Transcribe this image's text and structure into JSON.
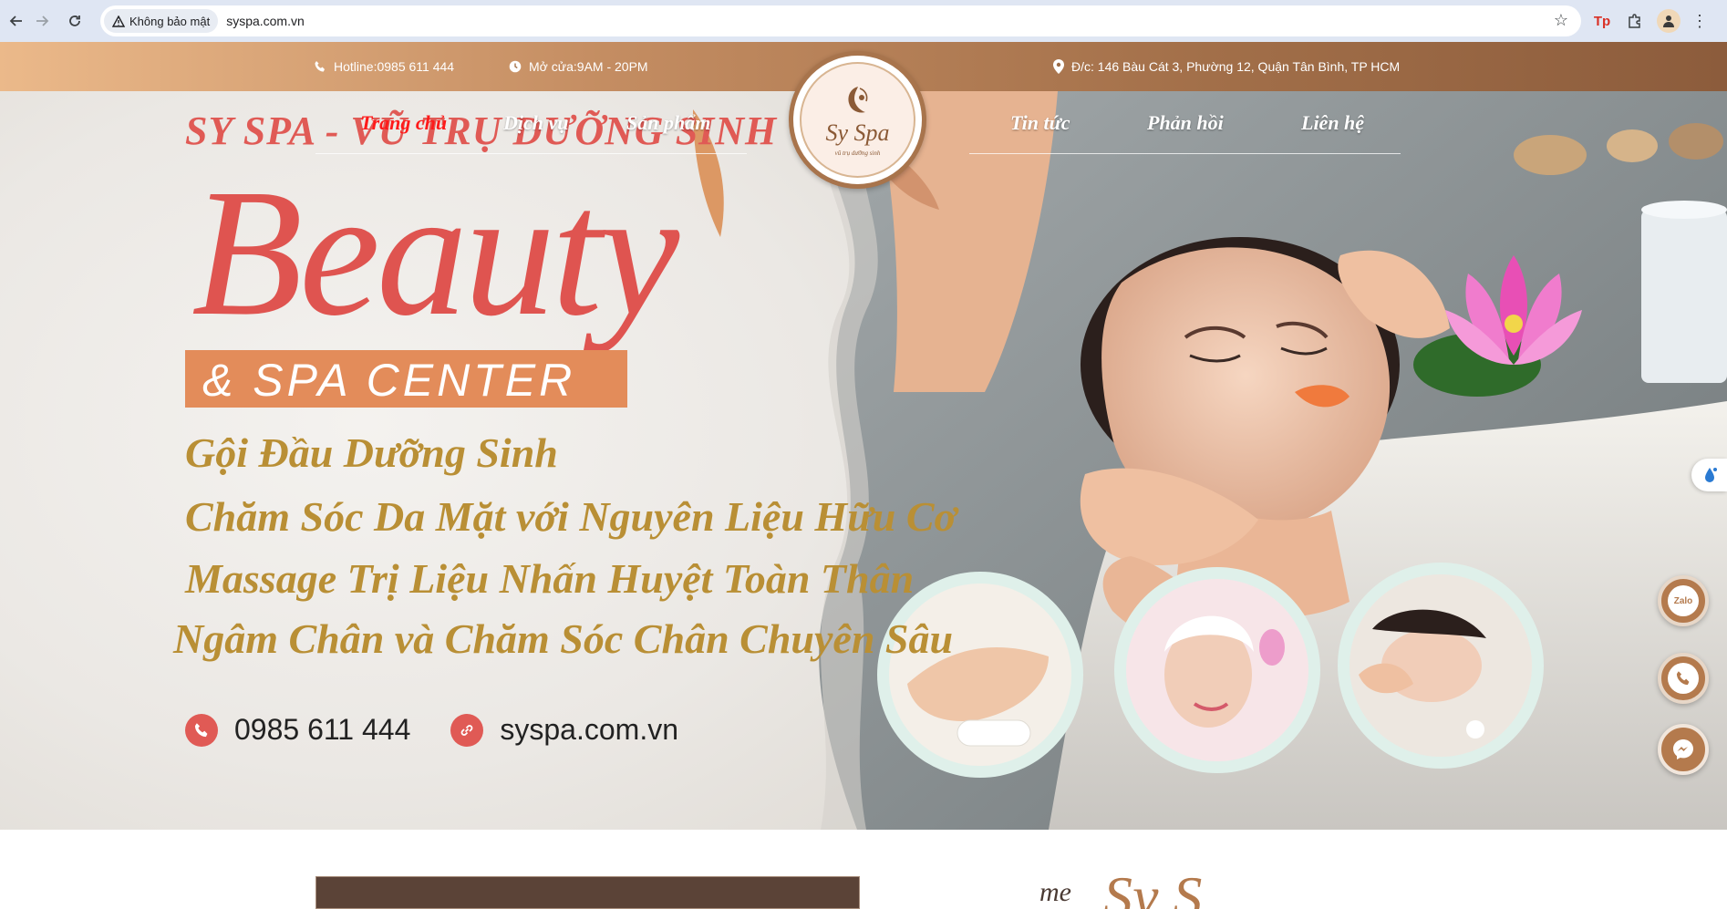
{
  "browser": {
    "security_label": "Không bảo mật",
    "url": "syspa.com.vn",
    "extension_label": "Tp"
  },
  "topbar": {
    "hotline": "Hotline:0985 611 444",
    "hours": "Mở cửa:9AM - 20PM",
    "address": "Đ/c: 146 Bàu Cát 3, Phường 12, Quận Tân Bình, TP HCM"
  },
  "nav": {
    "items": [
      {
        "label": "Trang chủ",
        "active": true
      },
      {
        "label": "Dịch vụ"
      },
      {
        "label": "Sản phẩm"
      },
      {
        "label": "Tin tức"
      },
      {
        "label": "Phản hồi"
      },
      {
        "label": "Liên hệ"
      }
    ]
  },
  "logo": {
    "brand": "Sy Spa",
    "sub": "vũ trụ dưỡng sinh"
  },
  "hero": {
    "tagline": "SY SPA - VŨ TRỤ DƯỠNG SINH",
    "headline": "Beauty",
    "subheadline": "& SPA CENTER",
    "services": [
      "Gội Đầu Dưỡng Sinh",
      "Chăm Sóc Da Mặt với Nguyên Liệu Hữu Cơ",
      "Massage Trị Liệu Nhấn Huyệt Toàn Thân",
      "Ngâm Chân và Chăm Sóc Chân Chuyên Sâu"
    ],
    "phone": "0985 611 444",
    "website": "syspa.com.vn"
  },
  "floating": {
    "zalo_label": "Zalo"
  },
  "below": {
    "welcome": "me",
    "script": "Sy S"
  },
  "colors": {
    "brand_brown": "#b47a4d",
    "tagline_red": "#e05a55",
    "service_gold": "#b98f35",
    "active_nav": "#ff1a1a"
  }
}
